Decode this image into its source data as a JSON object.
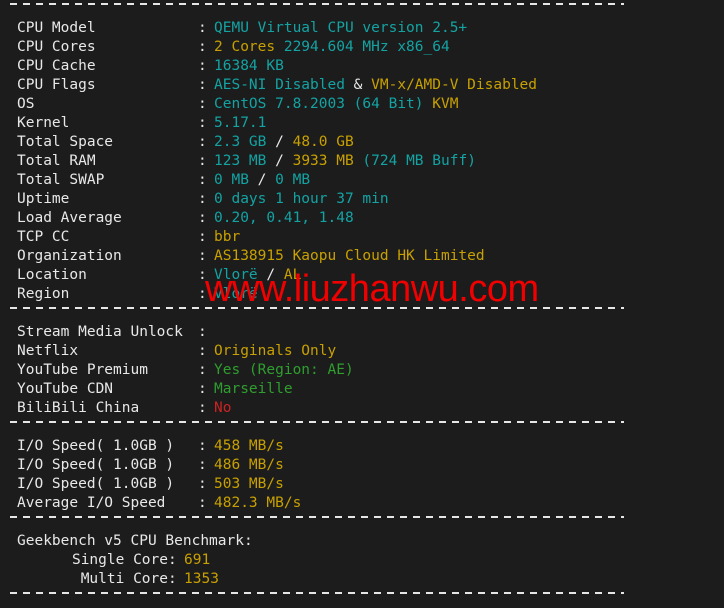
{
  "terminal": {
    "background": "#1c1c1c",
    "colors": {
      "label": "#e8e8e8",
      "cyan": "#14a3a3",
      "yellow": "#c8a000",
      "green": "#2f9e2f",
      "red": "#cc2222",
      "separator": "#e6e6e6",
      "watermark": "#f00000"
    },
    "watermark": "www.liuzhanwu.com",
    "colon": ":",
    "system": [
      {
        "label": "CPU Model",
        "parts": [
          {
            "text": "QEMU Virtual CPU version 2.5+",
            "color": "cyan"
          }
        ]
      },
      {
        "label": "CPU Cores",
        "parts": [
          {
            "text": "2 Cores",
            "color": "yellow"
          },
          {
            "text": " 2294.604 MHz x86_64",
            "color": "cyan"
          }
        ]
      },
      {
        "label": "CPU Cache",
        "parts": [
          {
            "text": "16384 KB",
            "color": "cyan"
          }
        ]
      },
      {
        "label": "CPU Flags",
        "parts": [
          {
            "text": "AES-NI Disabled",
            "color": "cyan"
          },
          {
            "text": " & ",
            "color": "white"
          },
          {
            "text": "VM-x/AMD-V Disabled",
            "color": "yellow"
          }
        ]
      },
      {
        "label": "OS",
        "parts": [
          {
            "text": "CentOS 7.8.2003 (64 Bit)",
            "color": "cyan"
          },
          {
            "text": " ",
            "color": "white"
          },
          {
            "text": "KVM",
            "color": "yellow"
          }
        ]
      },
      {
        "label": "Kernel",
        "parts": [
          {
            "text": "5.17.1",
            "color": "cyan"
          }
        ]
      },
      {
        "label": "Total Space",
        "parts": [
          {
            "text": "2.3 GB",
            "color": "cyan"
          },
          {
            "text": " / ",
            "color": "white"
          },
          {
            "text": "48.0 GB",
            "color": "yellow"
          }
        ]
      },
      {
        "label": "Total RAM",
        "parts": [
          {
            "text": "123 MB",
            "color": "cyan"
          },
          {
            "text": " / ",
            "color": "white"
          },
          {
            "text": "3933 MB",
            "color": "yellow"
          },
          {
            "text": " (724 MB Buff)",
            "color": "cyan"
          }
        ]
      },
      {
        "label": "Total SWAP",
        "parts": [
          {
            "text": "0 MB",
            "color": "cyan"
          },
          {
            "text": " / ",
            "color": "white"
          },
          {
            "text": "0 MB",
            "color": "cyan"
          }
        ]
      },
      {
        "label": "Uptime",
        "parts": [
          {
            "text": "0 days 1 hour 37 min",
            "color": "cyan"
          }
        ]
      },
      {
        "label": "Load Average",
        "parts": [
          {
            "text": "0.20, 0.41, 1.48",
            "color": "cyan"
          }
        ]
      },
      {
        "label": "TCP CC",
        "parts": [
          {
            "text": "bbr",
            "color": "yellow"
          }
        ]
      },
      {
        "label": "Organization",
        "parts": [
          {
            "text": "AS138915 Kaopu Cloud HK Limited",
            "color": "yellow"
          }
        ]
      },
      {
        "label": "Location",
        "parts": [
          {
            "text": "Vlorë",
            "color": "cyan"
          },
          {
            "text": " / ",
            "color": "white"
          },
          {
            "text": "AL",
            "color": "yellow"
          }
        ]
      },
      {
        "label": "Region",
        "parts": [
          {
            "text": "Vlorë",
            "color": "cyan"
          }
        ]
      }
    ],
    "stream": [
      {
        "label": "Stream Media Unlock",
        "parts": []
      },
      {
        "label": "Netflix",
        "parts": [
          {
            "text": "Originals Only",
            "color": "yellow"
          }
        ]
      },
      {
        "label": "YouTube Premium",
        "parts": [
          {
            "text": "Yes (Region: AE)",
            "color": "green"
          }
        ]
      },
      {
        "label": "YouTube CDN",
        "parts": [
          {
            "text": "Marseille",
            "color": "green"
          }
        ]
      },
      {
        "label": "BiliBili China",
        "parts": [
          {
            "text": "No",
            "color": "red"
          }
        ]
      }
    ],
    "io": [
      {
        "label": "I/O Speed( 1.0GB )",
        "parts": [
          {
            "text": "458 MB/s",
            "color": "yellow"
          }
        ]
      },
      {
        "label": "I/O Speed( 1.0GB )",
        "parts": [
          {
            "text": "486 MB/s",
            "color": "yellow"
          }
        ]
      },
      {
        "label": "I/O Speed( 1.0GB )",
        "parts": [
          {
            "text": "503 MB/s",
            "color": "yellow"
          }
        ]
      },
      {
        "label": "Average I/O Speed",
        "parts": [
          {
            "text": "482.3 MB/s",
            "color": "yellow"
          }
        ]
      }
    ],
    "geekbench": {
      "heading": "Geekbench v5 CPU Benchmark:",
      "rows": [
        {
          "label": "Single Core",
          "parts": [
            {
              "text": "691",
              "color": "yellow"
            }
          ]
        },
        {
          "label": "Multi Core",
          "parts": [
            {
              "text": "1353",
              "color": "yellow"
            }
          ]
        }
      ]
    }
  }
}
